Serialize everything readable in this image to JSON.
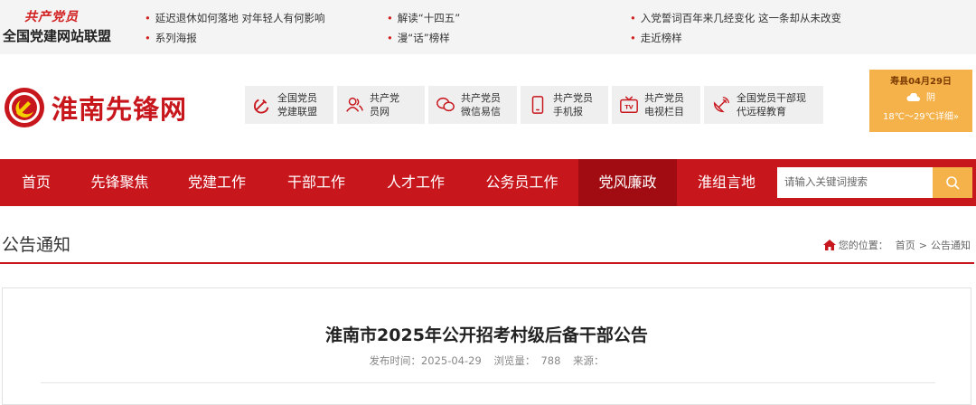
{
  "topbar": {
    "alliance_script": "共产党员",
    "alliance_name": "全国党建网站联盟",
    "links": [
      {
        "label": "延迟退休如何落地 对年轻人有何影响"
      },
      {
        "label": "系列海报"
      },
      {
        "label": "解读“十四五”"
      },
      {
        "label": "漫“话”榜样"
      },
      {
        "label": "入党誓词百年来几经变化 这一条却从未改变"
      },
      {
        "label": "走近榜样"
      }
    ]
  },
  "header": {
    "logo_text": "淮南先锋网",
    "quick_links": [
      {
        "line1": "全国党员",
        "line2": "党建联盟",
        "icon": "hammer-sickle-icon"
      },
      {
        "line1": "共产党",
        "line2": "员网",
        "icon": "users-icon"
      },
      {
        "line1": "共产党员",
        "line2": "微信易信",
        "icon": "wechat-icon"
      },
      {
        "line1": "共产党员",
        "line2": "手机报",
        "icon": "mobile-icon"
      },
      {
        "line1": "共产党员",
        "line2": "电视栏目",
        "icon": "tv-icon"
      },
      {
        "line1": "全国党员干部现",
        "line2": "代远程教育",
        "icon": "satellite-icon"
      }
    ],
    "weather": {
      "city_date": "寿县04月29日",
      "condition": "阴",
      "temp_detail": "18℃～29℃详细»"
    }
  },
  "nav": {
    "items": [
      {
        "label": "首页"
      },
      {
        "label": "先锋聚焦"
      },
      {
        "label": "党建工作"
      },
      {
        "label": "干部工作"
      },
      {
        "label": "人才工作"
      },
      {
        "label": "公务员工作"
      },
      {
        "label": "党风廉政",
        "active": true
      },
      {
        "label": "淮组言地"
      }
    ],
    "search_placeholder": "请输入关键词搜索"
  },
  "breadcrumb": {
    "section_title": "公告通知",
    "prefix": "您的位置：",
    "home": "首页",
    "separator": ">",
    "current": "公告通知"
  },
  "article": {
    "title": "淮南市2025年公开招考村级后备干部公告",
    "publish_label": "发布时间：2025-04-29",
    "views_label": "浏览量：",
    "views_value": "788",
    "source_label": "来源："
  },
  "colors": {
    "primary_red": "#c8161d",
    "active_red": "#a10c12",
    "accent_orange": "#f5b24a"
  }
}
